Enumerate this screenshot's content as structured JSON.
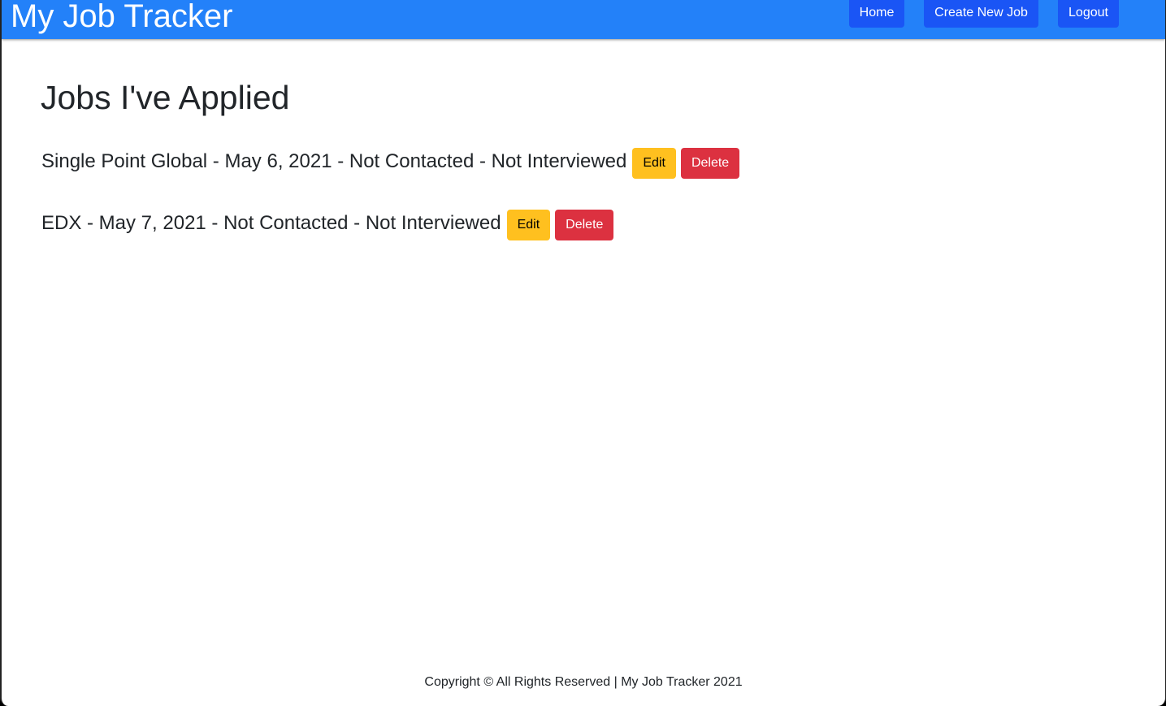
{
  "app": {
    "brand": "My Job Tracker"
  },
  "nav": {
    "home_label": "Home",
    "create_label": "Create New Job",
    "logout_label": "Logout"
  },
  "main": {
    "title": "Jobs I've Applied",
    "jobs": [
      {
        "text": "Single Point Global - May 6, 2021 - Not Contacted - Not Interviewed",
        "edit_label": "Edit",
        "delete_label": "Delete"
      },
      {
        "text": "EDX - May 7, 2021 - Not Contacted - Not Interviewed",
        "edit_label": "Edit",
        "delete_label": "Delete"
      }
    ]
  },
  "footer": {
    "text": "Copyright © All Rights Reserved | My Job Tracker 2021"
  },
  "colors": {
    "navbar": "#2381f9",
    "nav_button": "#1a55f5",
    "edit_button": "#ffc01f",
    "delete_button": "#dc3140",
    "text": "#212529"
  }
}
